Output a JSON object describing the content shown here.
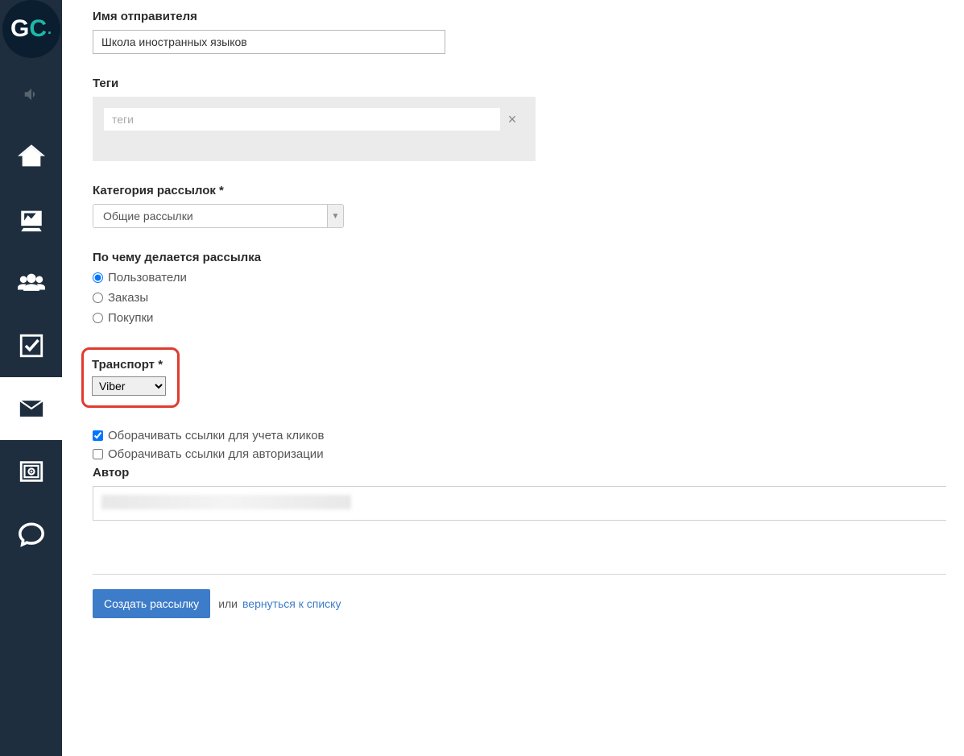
{
  "sidebar": {
    "logo": {
      "g": "G",
      "c": "C",
      "dot": "."
    },
    "items": [
      {
        "name": "sound-icon"
      },
      {
        "name": "home-icon"
      },
      {
        "name": "chart-icon"
      },
      {
        "name": "users-icon"
      },
      {
        "name": "check-icon"
      },
      {
        "name": "mail-icon"
      },
      {
        "name": "safe-icon"
      },
      {
        "name": "chat-icon"
      }
    ]
  },
  "form": {
    "sender_label": "Имя отправителя",
    "sender_value": "Школа иностранных языков",
    "tags_label": "Теги",
    "tags_placeholder": "теги",
    "tags_clear": "×",
    "category_label": "Категория рассылок *",
    "category_value": "Общие рассылки",
    "basis_label": "По чему делается рассылка",
    "basis_options": [
      {
        "label": "Пользователи",
        "checked": true
      },
      {
        "label": "Заказы",
        "checked": false
      },
      {
        "label": "Покупки",
        "checked": false
      }
    ],
    "transport_label": "Транспорт *",
    "transport_value": "Viber",
    "wrap_clicks": {
      "label": "Оборачивать ссылки для учета кликов",
      "checked": true
    },
    "wrap_auth": {
      "label": "Оборачивать ссылки для авторизации",
      "checked": false
    },
    "author_label": "Автор",
    "author_value": ""
  },
  "actions": {
    "submit": "Создать рассылку",
    "or": "или",
    "back": "вернуться к списку"
  }
}
